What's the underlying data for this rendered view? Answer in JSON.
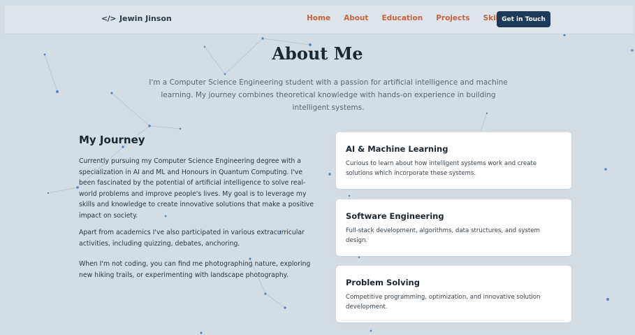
{
  "nav": {
    "brand_code": "</>",
    "brand_name": "Jewin Jinson",
    "links": [
      "Home",
      "About",
      "Education",
      "Projects",
      "Skills"
    ],
    "cta": "Get in Touch"
  },
  "about": {
    "title": "About Me",
    "intro": "I'm a Computer Science Engineering student with a passion for artificial intelligence and machine learning. My journey combines theoretical knowledge with hands-on experience in building intelligent systems."
  },
  "journey": {
    "title": "My Journey",
    "paragraphs": [
      "Currently pursuing my Computer Science Engineering degree with a specialization in AI and ML and Honours in Quantum Computing. I've been fascinated by the potential of artificial intelligence to solve real-world problems and improve people's lives. My goal is to leverage my skills and knowledge to create innovative solutions that make a positive impact on society.",
      "Apart from academics I've also participated in various extracurricular activities, including quizzing, debates, anchoring.",
      "When I'm not coding, you can find me photographing nature, exploring new hiking trails, or experimenting with landscape photography."
    ]
  },
  "cards": [
    {
      "title": "AI & Machine Learning",
      "desc": "Curious to learn about how intelligent systems work and create solutions which incorporate these systems."
    },
    {
      "title": "Software Engineering",
      "desc": "Full-stack development, algorithms, data structures, and system design."
    },
    {
      "title": "Problem Solving",
      "desc": "Competitive programming, optimization, and innovative solution development."
    }
  ],
  "colors": {
    "background": "#d4dde3",
    "accent": "#c4633c",
    "button": "#1d3a5b",
    "node": "#4a78b0"
  }
}
